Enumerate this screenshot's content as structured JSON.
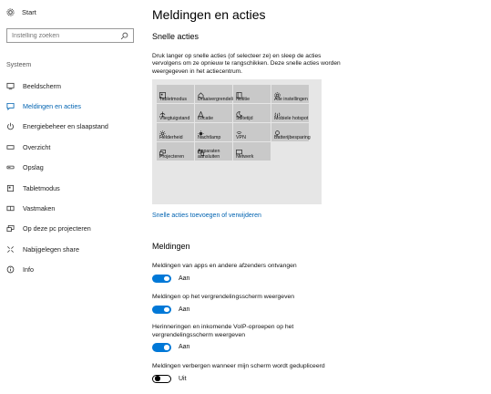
{
  "sidebar": {
    "home_label": "Start",
    "search_placeholder": "Instelling zoeken",
    "section_label": "Systeem",
    "items": [
      {
        "label": "Beeldscherm",
        "icon": "monitor-icon"
      },
      {
        "label": "Meldingen en acties",
        "icon": "notification-icon",
        "active": true
      },
      {
        "label": "Energiebeheer en slaapstand",
        "icon": "power-icon"
      },
      {
        "label": "Overzicht",
        "icon": "storage-icon"
      },
      {
        "label": "Opslag",
        "icon": "drive-icon"
      },
      {
        "label": "Tabletmodus",
        "icon": "tablet-icon"
      },
      {
        "label": "Vastmaken",
        "icon": "multitask-icon"
      },
      {
        "label": "Op deze pc projecteren",
        "icon": "project-icon"
      },
      {
        "label": "Nabijgelegen share",
        "icon": "share-icon"
      },
      {
        "label": "Info",
        "icon": "info-icon"
      }
    ]
  },
  "main": {
    "title": "Meldingen en acties",
    "quick_actions_heading": "Snelle acties",
    "quick_actions_desc": "Druk langer op snelle acties (of selecteer ze) en sleep de acties vervolgens om ze opnieuw te rangschikken. Deze snelle acties worden weergegeven in het actiecentrum.",
    "tiles": [
      {
        "label": "Tabletmodus",
        "icon": "tablet-icon"
      },
      {
        "label": "Draaivergrendeling",
        "icon": "rotation-lock-icon"
      },
      {
        "label": "Notitie",
        "icon": "note-icon"
      },
      {
        "label": "Alle instellingen",
        "icon": "gear-icon"
      },
      {
        "label": "Vliegtuigstand",
        "icon": "airplane-icon"
      },
      {
        "label": "Locatie",
        "icon": "location-icon"
      },
      {
        "label": "Stiltetijd",
        "icon": "moon-icon"
      },
      {
        "label": "Mobiele hotspot",
        "icon": "hotspot-icon"
      },
      {
        "label": "Helderheid",
        "icon": "sun-icon"
      },
      {
        "label": "Nachtlamp",
        "icon": "night-light-icon"
      },
      {
        "label": "VPN",
        "icon": "vpn-icon"
      },
      {
        "label": "Batterijbesparing",
        "icon": "battery-saver-icon"
      },
      {
        "label": "Projecteren",
        "icon": "project-icon"
      },
      {
        "label": "Apparaten aansluiten",
        "icon": "connect-icon"
      },
      {
        "label": "Netwerk",
        "icon": "network-icon"
      }
    ],
    "add_remove_link": "Snelle acties toevoegen of verwijderen",
    "notifications_heading": "Meldingen",
    "settings": [
      {
        "text": "Meldingen van apps en andere afzenders ontvangen",
        "state": "Aan",
        "on": true
      },
      {
        "text": "Meldingen op het vergrendelingsscherm weergeven",
        "state": "Aan",
        "on": true
      },
      {
        "text": "Herinneringen en inkomende VoIP-oproepen op het vergrendelingsscherm weergeven",
        "state": "Aan",
        "on": true
      },
      {
        "text": "Meldingen verbergen wanneer mijn scherm wordt gedupliceerd",
        "state": "Uit",
        "on": false
      }
    ]
  },
  "colors": {
    "accent": "#0078d7",
    "link": "#0063b1",
    "tile_bg": "#c9c9c9",
    "grid_bg": "#e6e6e6"
  }
}
